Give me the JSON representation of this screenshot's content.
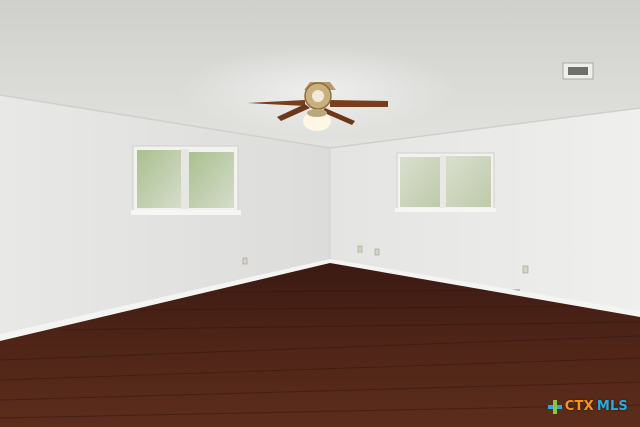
{
  "scene": {
    "description_type": "empty-room-photo",
    "icons": [
      "ceiling-fan-icon",
      "ceiling-vent-icon",
      "window-icon",
      "electrical-outlet-icon"
    ],
    "colors": {
      "ceiling": "#d9d9d6",
      "wall_left": "#e6e6e4",
      "wall_right": "#ebebea",
      "floor": "#4a2418",
      "trim": "#f4f4f2",
      "window_glass": "#b8c9a6",
      "fan_blade": "#7a3e1e"
    }
  },
  "watermark": {
    "brand_part1": "CTX",
    "brand_part2": "MLS",
    "colors": {
      "ctx": "#f7941d",
      "mls": "#29abe2"
    }
  }
}
